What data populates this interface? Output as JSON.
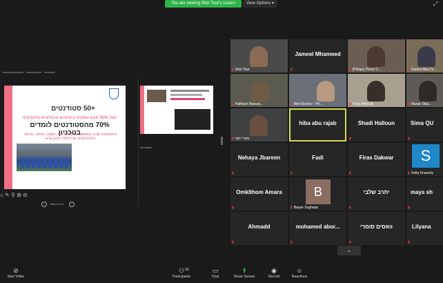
{
  "top_bar": {
    "banner": "You are viewing Shiri Tour's screen",
    "view_options": "View Options ▾",
    "topicon_glyph": "⤢"
  },
  "presentation": {
    "slide_title": "+50 סטודנטים",
    "slide_subtitle": "מעל 95% מהם עוסקים בתחומים טכנולוגיים מתקדמים",
    "slide_pct": "70% מהסטודנטים לומדים בטכניון",
    "slide_body": "בתעלתמה: מדעי המחשב, הנדסת מכונות, חשמל, רפואה, הנדסה ביוטכנולוגית, אדריכלות, תכנון ערים",
    "nav_text": "Slide 6 of 6",
    "notes_label": "No Notes",
    "tools_glyphs": "⌂ ✎ ⚲ ⊞ ⊖"
  },
  "participants": [
    {
      "name": "Shiri Tour",
      "label": "Shiri Tour",
      "video": true
    },
    {
      "name": "Jameel Mhameed",
      "label": "",
      "video": false
    },
    {
      "name": "[Philips] Pierre C...",
      "label": "[Philips] Pierre C...",
      "video": true
    },
    {
      "name": "Samira Abu-To...",
      "label": "Samira Abu-To...",
      "video": true
    },
    {
      "name": "Haitham Massar...",
      "label": "Haitham Massar...",
      "video": true
    },
    {
      "name": "Alex Kornev - Ph...",
      "label": "Alex Kornev - Ph...",
      "video": true
    },
    {
      "name": "Flora Abboud",
      "label": "Flora Abboud",
      "video": true
    },
    {
      "name": "Manar Sbla...",
      "label": "Manar Sbla...",
      "video": true
    },
    {
      "name": "מאלי יסוף",
      "label": "מאלי יסוף",
      "video": true
    },
    {
      "name": "hiba abu rajab",
      "label": "",
      "video": false
    },
    {
      "name": "Shadi Halloun",
      "label": "",
      "video": false
    },
    {
      "name": "Sima QU",
      "label": "",
      "video": false
    },
    {
      "name": "Nehaya Jbareen",
      "label": "",
      "video": false
    },
    {
      "name": "Fadi",
      "label": "",
      "video": false
    },
    {
      "name": "Firas Dakwar",
      "label": "",
      "video": false
    },
    {
      "name": "Sofia Drawshy",
      "label": "Sofia Drawshy",
      "video": false
    },
    {
      "name": "Omklthom Amara",
      "label": "",
      "video": false
    },
    {
      "name": "Bayan Zughalar",
      "label": "Bayan Zughalar",
      "video": false
    },
    {
      "name": "יתרב שלבי",
      "label": "",
      "video": false
    },
    {
      "name": "mays sh",
      "label": "",
      "video": false
    },
    {
      "name": "Ahmadd",
      "label": "",
      "video": false
    },
    {
      "name": "mohamed abor...",
      "label": "",
      "video": false
    },
    {
      "name": "וואסים סומרי",
      "label": "",
      "video": false
    },
    {
      "name": "Lilyana",
      "label": "",
      "video": false
    }
  ],
  "avatars": {
    "bayan_initial": "B",
    "sofia_initial": "S"
  },
  "gallery_chevron": "⌄",
  "bottom_bar": {
    "start_video": "Start Video",
    "participants": "Participants",
    "participants_count": "29",
    "chat": "Chat",
    "share_screen": "Share Screen",
    "record": "Record",
    "reactions": "Reactions"
  },
  "colors": {
    "banner_green": "#2fb34a",
    "active_speaker_border": "#d8e04a",
    "mic_muted_red": "#e03a3a",
    "slide_pink": "#ee6f86"
  }
}
